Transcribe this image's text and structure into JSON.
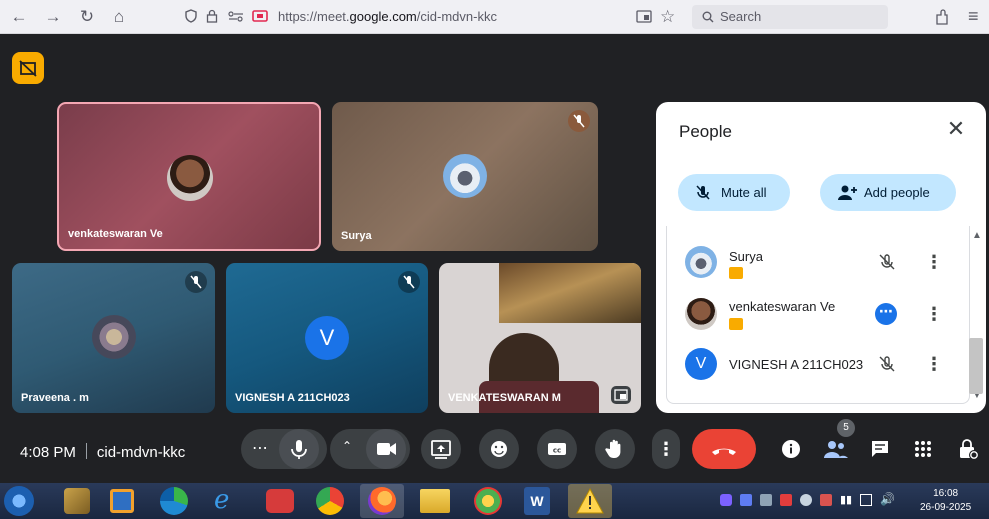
{
  "browser": {
    "url_prefix": "https://meet.",
    "url_domain": "google.com",
    "url_path": "/cid-mdvn-kkc",
    "search_placeholder": "Search"
  },
  "tiles": [
    {
      "name": "venkateswaran Ve",
      "muted": false
    },
    {
      "name": "Surya",
      "muted": true
    },
    {
      "name": "Praveena . m",
      "muted": true
    },
    {
      "name": "VIGNESH A 211CH023",
      "initial": "V",
      "muted": true
    },
    {
      "name": "VENKATESWARAN M",
      "muted": false
    }
  ],
  "people_panel": {
    "title": "People",
    "mute_all_label": "Mute all",
    "add_people_label": "Add people",
    "participants": [
      {
        "name": "Surya",
        "host": true
      },
      {
        "name": "venkateswaran Ve",
        "host": true
      },
      {
        "name": "VIGNESH A 211CH023",
        "initial": "V",
        "host": false
      }
    ]
  },
  "meeting": {
    "time": "4:08 PM",
    "code": "cid-mdvn-kkc",
    "people_count": "5"
  },
  "taskbar": {
    "time": "16:08",
    "date": "26-09-2025"
  },
  "colors": {
    "stage": "#202124",
    "accent_light": "#c2e7ff",
    "leave_red": "#ea4335",
    "host_badge": "#f9ab00",
    "vignesh_avatar": "#1a73e8"
  }
}
